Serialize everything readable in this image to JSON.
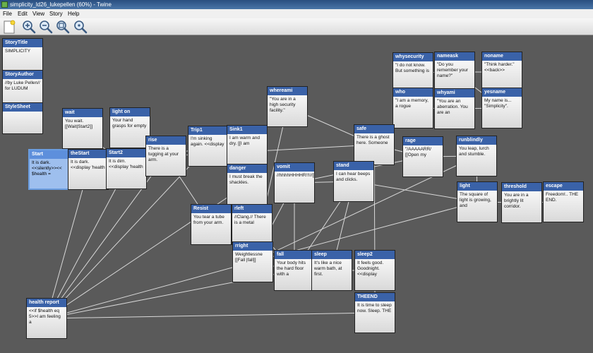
{
  "window": {
    "title": "simplicity_ld26_lukepellen (60%) - Twine"
  },
  "menu": {
    "file": "File",
    "edit": "Edit",
    "view": "View",
    "story": "Story",
    "help": "Help"
  },
  "toolbar": {
    "buttons": [
      {
        "name": "new-passage-button",
        "icon": "new-passage-icon"
      },
      {
        "name": "zoom-in-button",
        "icon": "zoom-in-icon"
      },
      {
        "name": "zoom-out-button",
        "icon": "zoom-out-icon"
      },
      {
        "name": "zoom-fit-button",
        "icon": "zoom-fit-icon"
      },
      {
        "name": "zoom-actual-button",
        "icon": "zoom-actual-icon"
      }
    ]
  },
  "colors": {
    "canvas": "#5a5a5a",
    "passage_title": "#3a62a8",
    "selected": "#9ebfee",
    "link": "#d8d8d8"
  },
  "passages": [
    {
      "id": "storytitle",
      "title": "StoryTitle",
      "excerpt": "SIMPLICITY"
    },
    {
      "id": "storyauthor",
      "title": "StoryAuthor",
      "excerpt": "//by Luke Pellen// for LUDUM"
    },
    {
      "id": "stylesheet",
      "title": "StyleSheet",
      "excerpt": ""
    },
    {
      "id": "start",
      "title": "Start",
      "excerpt": "It is dark. <<silently>><< $health =",
      "selected": true
    },
    {
      "id": "wait",
      "title": "wait",
      "excerpt": "You wait. [[Wait|Start2]]"
    },
    {
      "id": "lighton",
      "title": "light on",
      "excerpt": "Your hand grasps for empty"
    },
    {
      "id": "thestart",
      "title": "theStart",
      "excerpt": "It is dark. <<display 'health"
    },
    {
      "id": "start2",
      "title": "Start2",
      "excerpt": "It is dim. <<display 'health"
    },
    {
      "id": "rise",
      "title": "rise",
      "excerpt": "There is a tugging at your arm."
    },
    {
      "id": "trip1",
      "title": "Trip1",
      "excerpt": "I'm sinking again. <<display"
    },
    {
      "id": "sink1",
      "title": "Sink1",
      "excerpt": "I am warm and dry. [[I am"
    },
    {
      "id": "danger",
      "title": "danger",
      "excerpt": "I must break the shackles."
    },
    {
      "id": "whereami",
      "title": "whereami",
      "excerpt": "\"You are in a high security facility.\""
    },
    {
      "id": "whysecurity",
      "title": "whysecurity",
      "excerpt": "\"I do not know. But something is"
    },
    {
      "id": "nameask",
      "title": "nameask",
      "excerpt": "\"Do you remember your name?\""
    },
    {
      "id": "noname",
      "title": "noname",
      "excerpt": "\"Think harder.\" <<back>>"
    },
    {
      "id": "who",
      "title": "who",
      "excerpt": "\"I am a memory, a rogue"
    },
    {
      "id": "whyami",
      "title": "whyami",
      "excerpt": "\"You are an aberration. You are an"
    },
    {
      "id": "yesname",
      "title": "yesname",
      "excerpt": "My name is... \"Simplicity\"."
    },
    {
      "id": "safe",
      "title": "safe",
      "excerpt": "There is a ghost here. Someone"
    },
    {
      "id": "rage",
      "title": "rage",
      "excerpt": "\"/AAAAARR/ [[Open my"
    },
    {
      "id": "runblindly",
      "title": "runblindly",
      "excerpt": "You leap, lurch and stumble."
    },
    {
      "id": "vomit",
      "title": "vomit",
      "excerpt": "//hhhhHHHHR!!!//[[Stand"
    },
    {
      "id": "stand",
      "title": "stand",
      "excerpt": "I can hear beeps and clicks."
    },
    {
      "id": "light",
      "title": "light",
      "excerpt": "The square of light is growing, and"
    },
    {
      "id": "threshold",
      "title": "threshold",
      "excerpt": "You are in a brightly lit corridor."
    },
    {
      "id": "escape",
      "title": "escape",
      "excerpt": "Freedom!.. THE END."
    },
    {
      "id": "resist",
      "title": "Resist",
      "excerpt": "You tear a tube from your arm."
    },
    {
      "id": "rleft",
      "title": "rleft",
      "excerpt": "//Clang.// There is a metal"
    },
    {
      "id": "rright",
      "title": "rright",
      "excerpt": "Weightlessne [[Fall |fall]]"
    },
    {
      "id": "fall",
      "title": "fall",
      "excerpt": "Your body hits the hard floor with a"
    },
    {
      "id": "sleep",
      "title": "sleep",
      "excerpt": "It's like a nice warm bath, at first."
    },
    {
      "id": "sleep2",
      "title": "sleep2",
      "excerpt": "It feels good. Goodnight. <<display"
    },
    {
      "id": "healthreport",
      "title": "health report",
      "excerpt": "<<if $health eq 5>>I am feeling a"
    },
    {
      "id": "theend",
      "title": "THEEND",
      "excerpt": "It is time to sleep now. Sleep. THE"
    }
  ],
  "links": [
    [
      "start",
      "thestart"
    ],
    [
      "thestart",
      "wait"
    ],
    [
      "wait",
      "start2"
    ],
    [
      "start2",
      "lighton"
    ],
    [
      "lighton",
      "start2"
    ],
    [
      "start2",
      "rise"
    ],
    [
      "rise",
      "trip1"
    ],
    [
      "rise",
      "resist"
    ],
    [
      "trip1",
      "sink1"
    ],
    [
      "trip1",
      "danger"
    ],
    [
      "sink1",
      "danger"
    ],
    [
      "trip1",
      "healthreport"
    ],
    [
      "rise",
      "healthreport"
    ],
    [
      "start2",
      "healthreport"
    ],
    [
      "thestart",
      "healthreport"
    ],
    [
      "rise",
      "safe"
    ],
    [
      "safe",
      "whereami"
    ],
    [
      "whereami",
      "rright"
    ],
    [
      "safe",
      "who"
    ],
    [
      "who",
      "whyami"
    ],
    [
      "who",
      "whysecurity"
    ],
    [
      "whysecurity",
      "nameask"
    ],
    [
      "nameask",
      "noname"
    ],
    [
      "nameask",
      "yesname"
    ],
    [
      "yesname",
      "whyami"
    ],
    [
      "whysecurity",
      "who"
    ],
    [
      "safe",
      "stand"
    ],
    [
      "safe",
      "sleep2"
    ],
    [
      "safe",
      "rage"
    ],
    [
      "rage",
      "runblindly"
    ],
    [
      "rage",
      "vomit"
    ],
    [
      "runblindly",
      "light"
    ],
    [
      "light",
      "threshold"
    ],
    [
      "threshold",
      "escape"
    ],
    [
      "vomit",
      "stand"
    ],
    [
      "stand",
      "light"
    ],
    [
      "stand",
      "fall"
    ],
    [
      "stand",
      "sleep"
    ],
    [
      "vomit",
      "rright"
    ],
    [
      "resist",
      "rleft"
    ],
    [
      "resist",
      "rright"
    ],
    [
      "rleft",
      "fall"
    ],
    [
      "rright",
      "fall"
    ],
    [
      "rright",
      "healthreport"
    ],
    [
      "healthreport",
      "theend"
    ],
    [
      "sleep2",
      "theend"
    ],
    [
      "sleep",
      "sleep2"
    ],
    [
      "fall",
      "healthreport"
    ],
    [
      "light",
      "rright"
    ],
    [
      "runblindly",
      "rright"
    ],
    [
      "vomit",
      "fall"
    ],
    [
      "danger",
      "healthreport"
    ]
  ]
}
